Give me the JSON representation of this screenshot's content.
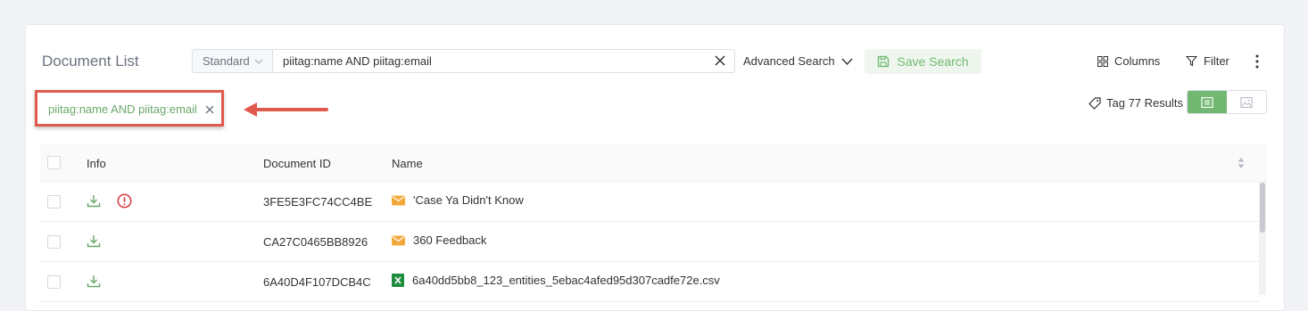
{
  "header": {
    "title": "Document List",
    "mode_select": "Standard",
    "search_value": "piitag:name AND piitag:email",
    "advanced_search": "Advanced Search",
    "save_search": "Save Search",
    "columns": "Columns",
    "filter": "Filter"
  },
  "active_tag": {
    "label": "piitag:name AND piitag:email"
  },
  "results": {
    "label": "Tag 77 Results"
  },
  "table": {
    "columns": [
      "Info",
      "Document ID",
      "Name"
    ],
    "rows": [
      {
        "id": "3FE5E3FC74CC4BE",
        "name": "'Case Ya Didn't Know",
        "type": "email",
        "warning": true
      },
      {
        "id": "CA27C0465BB8926",
        "name": "360 Feedback",
        "type": "email",
        "warning": false
      },
      {
        "id": "6A40D4F107DCB4C",
        "name": "6a40dd5bb8_123_entities_5ebac4afed95d307cadfe72e.csv",
        "type": "excel",
        "warning": false
      }
    ]
  },
  "icons": {
    "download": "download-icon",
    "warning": "warning-circle-icon",
    "email": "envelope-icon",
    "excel": "excel-file-icon",
    "tag": "tag-icon",
    "list_view": "list-view-icon",
    "image_view": "image-view-icon"
  },
  "colors": {
    "accent_green": "#72b872",
    "annotation_red": "#e05a4e",
    "warning_red": "#d9363e",
    "email_orange": "#f2a93b",
    "excel_green": "#1e8e3e"
  }
}
